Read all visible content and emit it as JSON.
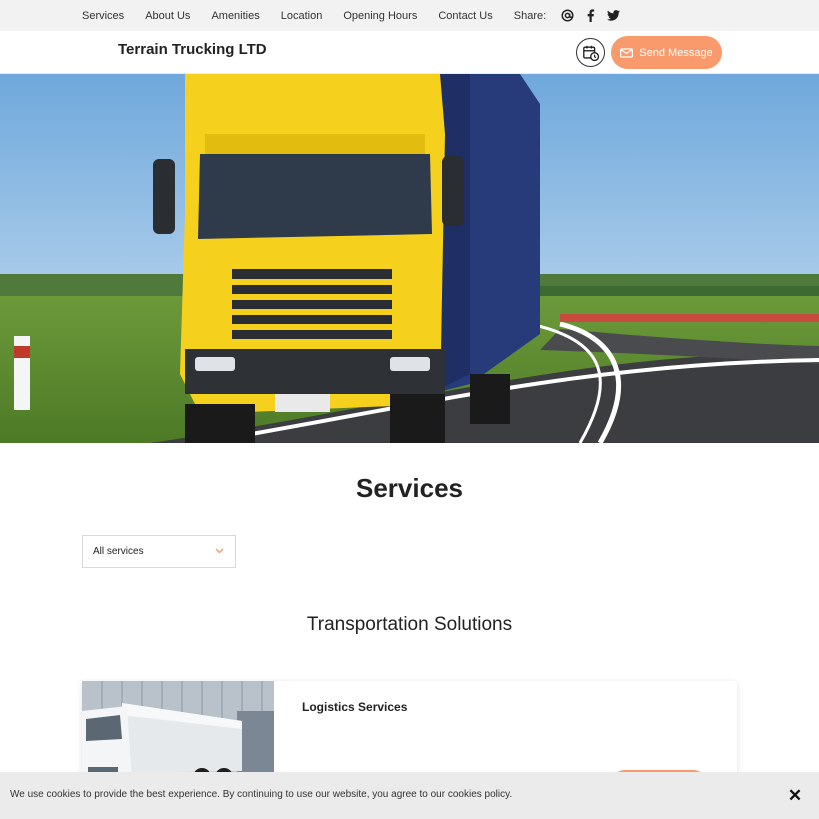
{
  "topnav": {
    "links": [
      "Services",
      "About Us",
      "Amenities",
      "Location",
      "Opening Hours",
      "Contact Us"
    ],
    "share_label": "Share:",
    "share_icons": [
      "email-icon",
      "facebook-icon",
      "twitter-icon"
    ]
  },
  "header": {
    "brand": "Terrain Trucking LTD",
    "calendar_icon": "calendar-clock-icon",
    "send_message_label": "Send Message",
    "send_message_icon": "envelope-icon"
  },
  "hero": {
    "image": "yellow-truck-on-road"
  },
  "services": {
    "title": "Services",
    "filter_value": "All services",
    "section_title": "Transportation Solutions",
    "cards": [
      {
        "title": "Logistics Services",
        "image": "white-trucks-at-warehouse"
      }
    ]
  },
  "cookie": {
    "text": "We use cookies to provide the best experience. By continuing to use our website, you agree to our cookies policy.",
    "close_icon": "close-icon"
  },
  "colors": {
    "accent": "#f89a6b",
    "topbar_bg": "#f2f2f2",
    "cookie_bg": "#ebebeb"
  }
}
